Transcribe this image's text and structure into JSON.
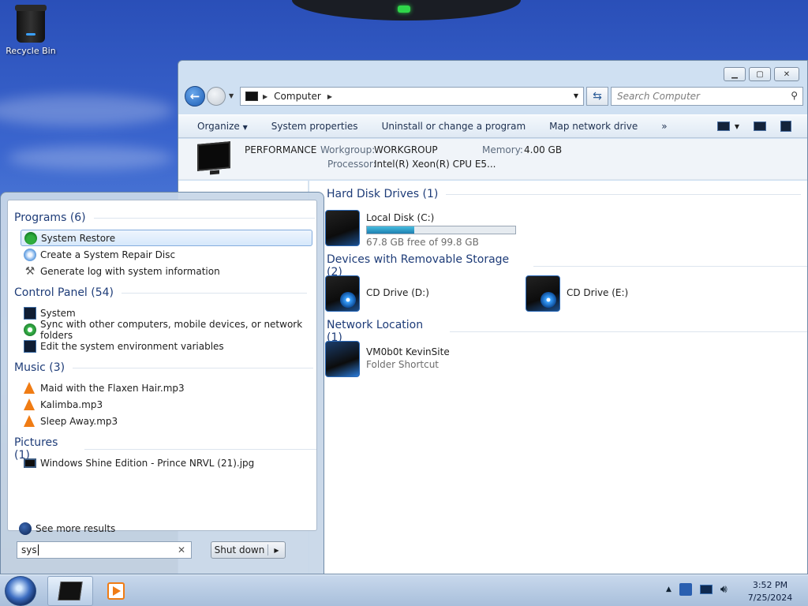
{
  "desktop": {
    "recycle_bin_label": "Recycle Bin"
  },
  "explorer": {
    "address": {
      "crumb": "Computer"
    },
    "search_placeholder": "Search Computer",
    "toolbar": {
      "organize": "Organize",
      "system_properties": "System properties",
      "uninstall": "Uninstall or change a program",
      "map_drive": "Map network drive",
      "more": "»"
    },
    "details": {
      "pc_name": "PERFORMANCE",
      "workgroup_label": "Workgroup:",
      "workgroup_value": "WORKGROUP",
      "memory_label": "Memory:",
      "memory_value": "4.00 GB",
      "processor_label": "Processor:",
      "processor_value": "Intel(R) Xeon(R) CPU E5..."
    },
    "groups": {
      "hdd": {
        "title": "Hard Disk Drives (1)",
        "drive_name": "Local Disk (C:)",
        "drive_free": "67.8 GB free of 99.8 GB",
        "used_fraction": 0.32
      },
      "removable": {
        "title": "Devices with Removable Storage (2)",
        "items": [
          "CD Drive (D:)",
          "CD Drive (E:)"
        ]
      },
      "network": {
        "title": "Network Location (1)",
        "item_name": "VM0b0t KevinSite",
        "item_sub": "Folder Shortcut"
      }
    }
  },
  "start_menu": {
    "categories": {
      "programs": "Programs (6)",
      "control_panel": "Control Panel (54)",
      "music": "Music (3)",
      "pictures": "Pictures (1)"
    },
    "programs": [
      "System Restore",
      "Create a System Repair Disc",
      "Generate log with system information"
    ],
    "control_panel": [
      "System",
      "Sync with other computers, mobile devices, or network folders",
      "Edit the system environment variables"
    ],
    "music": [
      "Maid with the Flaxen Hair.mp3",
      "Kalimba.mp3",
      "Sleep Away.mp3"
    ],
    "pictures": [
      "Windows Shine Edition - Prince NRVL (21).jpg"
    ],
    "see_more": "See more results",
    "search_value": "sys",
    "shutdown_label": "Shut down"
  },
  "taskbar": {
    "time": "3:52 PM",
    "date": "7/25/2024"
  }
}
